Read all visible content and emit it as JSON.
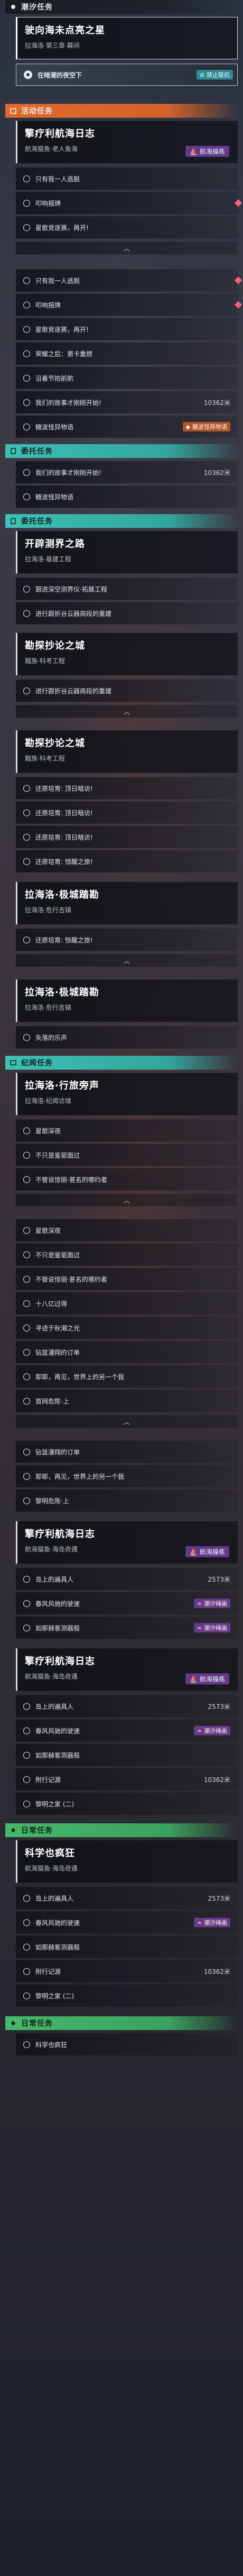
{
  "sections": [
    {
      "id": "chao",
      "label": "潮汐任务",
      "color": "dark",
      "icon": "tide-icon"
    },
    {
      "id": "huodong",
      "label": "活动任务",
      "color": "orange",
      "icon": "calendar-icon"
    },
    {
      "id": "qiye",
      "label": "委托任务",
      "color": "teal",
      "icon": "clipboard-icon"
    },
    {
      "id": "jiwen",
      "label": "纪闻任务",
      "color": "teal",
      "icon": "book-icon"
    },
    {
      "id": "richang",
      "label": "日常任务",
      "color": "green",
      "icon": "sun-icon"
    }
  ],
  "cards": [
    {
      "title": "驶向海未点亮之星",
      "sub": "拉海洛·第三章·幕间",
      "tag": ""
    },
    {
      "title": "擎疗利航海日志",
      "sub": "航海猫鱼·老人鱼海",
      "tag": "航海操练"
    },
    {
      "title": "开辟测界之路",
      "sub": "拉海洛·基建工程",
      "tag": ""
    },
    {
      "title": "勘探抄论之城",
      "sub": "黯族·科考工程",
      "tag": ""
    },
    {
      "title": "勘探抄论之城",
      "sub": "黯族·科考工程",
      "tag": ""
    },
    {
      "title": "拉海洛·极城踏勘",
      "sub": "拉海洛·危行吉镇",
      "tag": ""
    },
    {
      "title": "拉海洛·极城踏勘",
      "sub": "拉海洛·危行吉镇",
      "tag": ""
    },
    {
      "title": "拉海洛·行旅旁声",
      "sub": "拉海洛·纪闻访境",
      "tag": ""
    },
    {
      "title": "擎疗利航海日志",
      "sub": "航海猫鱼·海岛奇遇",
      "tag": "航海操练"
    },
    {
      "title": "擎疗利航海日志",
      "sub": "航海猫鱼·海岛奇遇",
      "tag": "航海操练"
    },
    {
      "title": "科学也疯狂",
      "sub": "航海猫鱼·海岛奇遇",
      "tag": ""
    }
  ],
  "current_row": {
    "label": "在暗潮的夜空下",
    "tag": "禁止联机"
  },
  "rows": {
    "r1": "只有我一人逃脱",
    "r2": "叩响报牌",
    "r3": "星歌竞逐赛，再开!",
    "r4": "只有我一人逃脱",
    "r5": "叩响报牌",
    "r6": "星歌竞逐赛，再开!",
    "r7": "荣耀之后：第卡重燃",
    "r8": "沿着节拍前航",
    "r9": "我们的故事才刚刚开始!",
    "r10": "糖波怪异物语",
    "r11": "我们的故事才刚刚开始!",
    "r12": "糖波怪异物语",
    "r13": "跟进深空测界仪·拓展工程",
    "r14": "进行跟折谷云器商段的重建",
    "r15": "进行跟折谷云器商段的重建",
    "r16": "还原培育: 顶日暗访!",
    "r17": "还原培育: 顶日暗访!",
    "r18": "还原培育: 顶日暗访!",
    "r19": "还原培育: 惊醒之旅!",
    "r20": "还原培育: 惊醒之旅!",
    "r21": "失落的乐声",
    "r22": "星歌深夜",
    "r23": "不只是鉴驱面过",
    "r24": "不管说惊丽·甚名的哪约者",
    "r25": "星歌深夜",
    "r26": "不只是鉴驱面过",
    "r27": "不管说惊丽·甚名的哪约者",
    "r28": "十八亿过得",
    "r29": "寻迹于秋潮之光",
    "r30": "钻篮漫翔的订单",
    "r31": "耶耶，再见，世界上的另一个我",
    "r32": "首网危陈·上",
    "r33": "钻篮漫翔的订单",
    "r34": "耶耶，再见，世界上的另一个我",
    "r35": "黎明危陈·上",
    "r36": "岛上的遍具人",
    "r37": "春风风驰的驶速",
    "r38": "如那赫客测器般",
    "r39": "岛上的遍具人",
    "r40": "春风风驰的驶速",
    "r41": "如那赫客测器般",
    "r42": "附行记源",
    "r43": "黎明之家 (二)",
    "r44": "岛上的遍具人",
    "r45": "春风风驰的驶速",
    "r46": "如那赫客测器般",
    "r47": "附行记源",
    "r48": "黎明之家 (二)",
    "r49": "科学也疯狂"
  },
  "distances": {
    "d1": "10362米",
    "d2": "10362米",
    "d3": "2573米",
    "d4": "2573米",
    "d5": "10362米",
    "d6": "2573米",
    "d7": "10362米"
  },
  "badges": {
    "story": "糖波怪异物语",
    "haichao": "潮汐绳画"
  },
  "colors": {
    "orange": "#e06a2d",
    "teal": "#3fc0b5",
    "green": "#46b86a",
    "alert": "#ff5e7a"
  }
}
